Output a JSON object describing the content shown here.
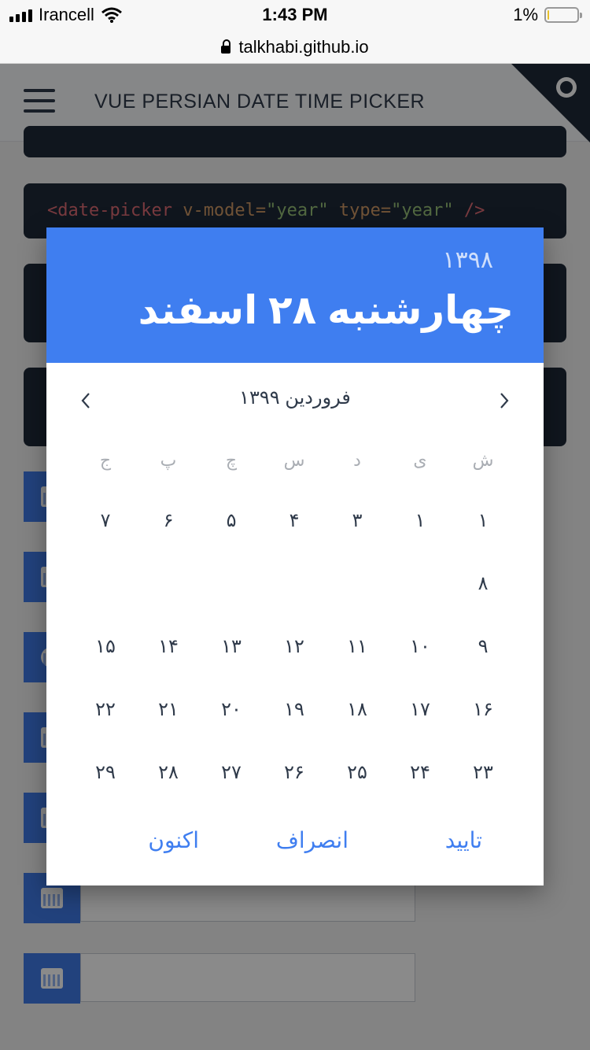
{
  "status_bar": {
    "carrier": "Irancell",
    "time": "1:43 PM",
    "battery": "1%",
    "battery_level": 0.05
  },
  "url_bar": {
    "domain": "talkhabi.github.io"
  },
  "header": {
    "title": "VUE PERSIAN DATE TIME PICKER"
  },
  "code_snippet": {
    "open": "<",
    "tag": "date-picker",
    "attr1": " v-model=",
    "val1": "\"year\"",
    "attr2": " type=",
    "val2": "\"year\"",
    "close": " />"
  },
  "picker": {
    "selected_year": "۱۳۹۸",
    "selected_date": "چهارشنبه ۲۸ اسفند",
    "month_label": "فروردین ۱۳۹۹",
    "weekdays": [
      "ش",
      "ی",
      "د",
      "س",
      "چ",
      "پ",
      "ج"
    ],
    "weeks": [
      [
        "۱",
        "۱",
        "۳",
        "۴",
        "۵",
        "۶",
        "۷"
      ],
      [
        "۸",
        "",
        "",
        "",
        "",
        "",
        ""
      ],
      [
        "۹",
        "۱۰",
        "۱۱",
        "۱۲",
        "۱۳",
        "۱۴",
        "۱۵"
      ],
      [
        "۱۶",
        "۱۷",
        "۱۸",
        "۱۹",
        "۲۰",
        "۲۱",
        "۲۲"
      ],
      [
        "۲۳",
        "۲۴",
        "۲۵",
        "۲۶",
        "۲۷",
        "۲۸",
        "۲۹"
      ]
    ],
    "actions": {
      "submit": "تایید",
      "cancel": "انصراف",
      "now": "اکنون"
    }
  },
  "colors": {
    "accent": "#3f7ef0",
    "code_bg": "#1f2a38"
  }
}
